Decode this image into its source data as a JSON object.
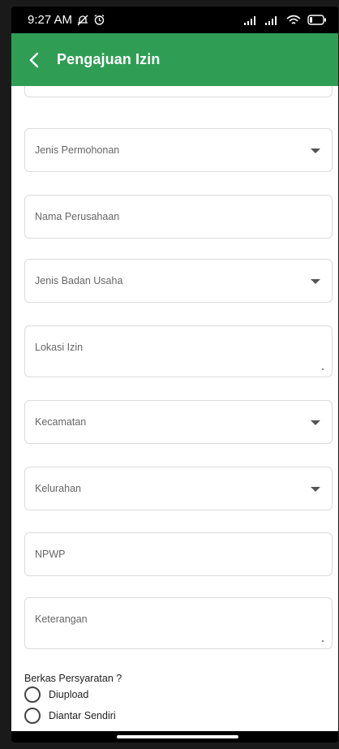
{
  "status": {
    "time": "9:27 AM",
    "icons": [
      "mute-icon",
      "alarm-icon",
      "signal-icon",
      "signal-icon",
      "wifi-icon",
      "battery-icon"
    ]
  },
  "appbar": {
    "title": "Pengajuan Izin",
    "back_icon": "chevron-left-icon",
    "color": "#2f9e54"
  },
  "form": {
    "jenis_permohonan": "Jenis Permohonan",
    "nama_perusahaan": "Nama Perusahaan",
    "jenis_badan_usaha": "Jenis Badan Usaha",
    "lokasi_izin": "Lokasi Izin",
    "kecamatan": "Kecamatan",
    "kelurahan": "Kelurahan",
    "npwp": "NPWP",
    "keterangan": "Keterangan",
    "berkas_title": "Berkas Persyaratan ?",
    "options": [
      "Diupload",
      "Diantar Sendiri"
    ]
  }
}
